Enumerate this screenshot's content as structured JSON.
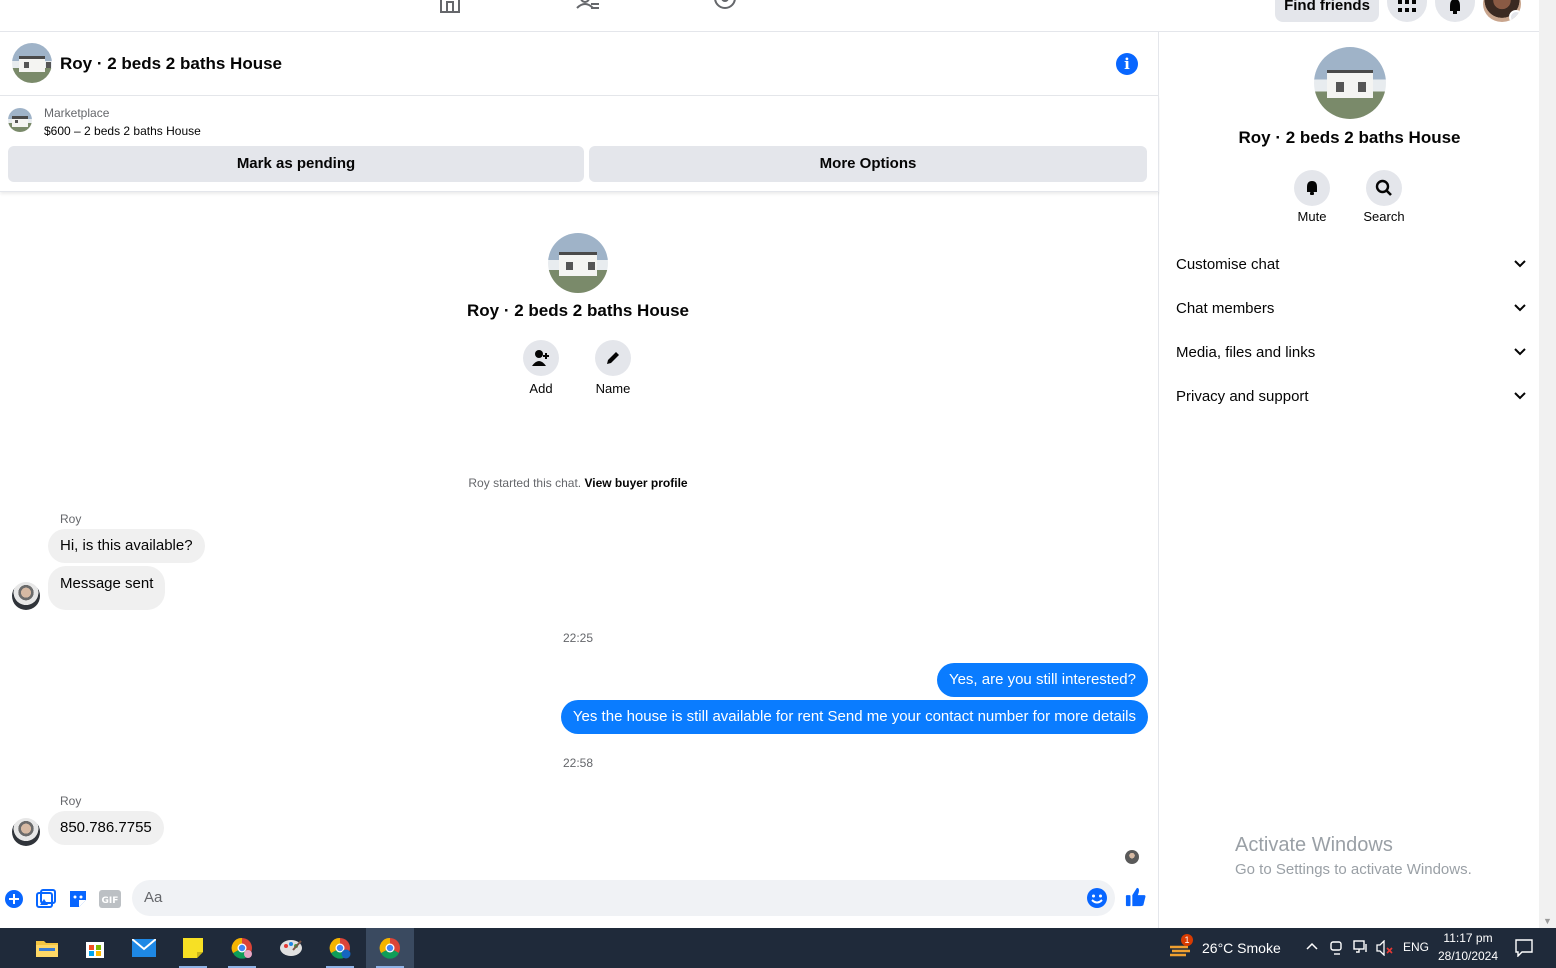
{
  "topbar": {
    "find_friends_label": "Find friends"
  },
  "chat_header": {
    "title": "Roy · 2 beds 2 baths House"
  },
  "marketplace": {
    "label": "Marketplace",
    "listing": "$600 – 2 beds 2 baths House",
    "mark_pending_label": "Mark as pending",
    "more_options_label": "More Options"
  },
  "chat_intro": {
    "title": "Roy · 2 beds 2 baths House",
    "add_label": "Add",
    "name_label": "Name",
    "started_text": "Roy started this chat.",
    "view_profile_label": "View buyer profile"
  },
  "messages": {
    "sender1": "Roy",
    "m1": "Hi, is this available?",
    "m2": "Message sent",
    "time1": "22:25",
    "m3": "Yes, are you still interested?",
    "m4": "Yes the house is still available for rent Send me your contact number for more details",
    "time2": "22:58",
    "sender2": "Roy",
    "m5": "850.786.7755"
  },
  "composer": {
    "placeholder": "Aa"
  },
  "side_panel": {
    "title": "Roy · 2 beds 2 baths House",
    "mute_label": "Mute",
    "search_label": "Search",
    "sections": [
      "Customise chat",
      "Chat members",
      "Media, files and links",
      "Privacy and support"
    ],
    "activate_title": "Activate Windows",
    "activate_sub": "Go to Settings to activate Windows."
  },
  "taskbar": {
    "weather": "26°C  Smoke",
    "weather_badge": "1",
    "language": "ENG",
    "time": "11:17 pm",
    "date": "28/10/2024"
  },
  "colors": {
    "accent": "#0866ff",
    "outgoing_bubble": "#0a7cff",
    "incoming_bubble": "#f0f0f0",
    "button_bg": "#e4e6eb",
    "taskbar_bg": "#1f2a3a"
  }
}
